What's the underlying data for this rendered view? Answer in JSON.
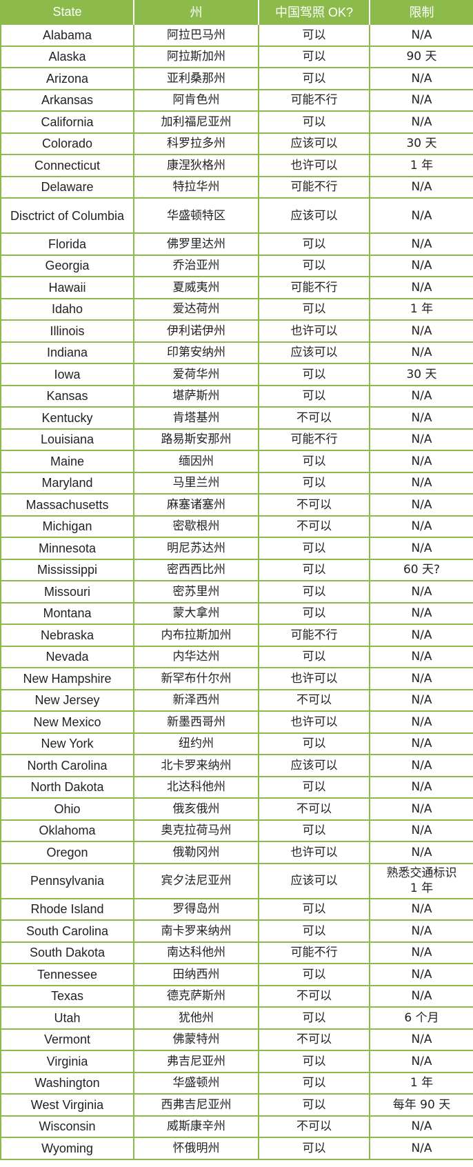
{
  "header": {
    "state": "State",
    "zhou": "州",
    "chinese_license_ok": "中国驾照 OK?",
    "restriction": "限制"
  },
  "colors": {
    "accent": "#8dbb4b",
    "header_text": "#ffffff",
    "body_text": "#222222"
  },
  "rows": [
    {
      "state": "Alabama",
      "zhou": "阿拉巴马州",
      "ok": "可以",
      "limit": "N/A"
    },
    {
      "state": "Alaska",
      "zhou": "阿拉斯加州",
      "ok": "可以",
      "limit": "90 天"
    },
    {
      "state": "Arizona",
      "zhou": "亚利桑那州",
      "ok": "可以",
      "limit": "N/A"
    },
    {
      "state": "Arkansas",
      "zhou": "阿肯色州",
      "ok": "可能不行",
      "limit": "N/A"
    },
    {
      "state": "California",
      "zhou": "加利福尼亚州",
      "ok": "可以",
      "limit": "N/A"
    },
    {
      "state": "Colorado",
      "zhou": "科罗拉多州",
      "ok": "应该可以",
      "limit": "30 天"
    },
    {
      "state": "Connecticut",
      "zhou": "康涅狄格州",
      "ok": "也许可以",
      "limit": "1 年"
    },
    {
      "state": "Delaware",
      "zhou": "特拉华州",
      "ok": "可能不行",
      "limit": "N/A"
    },
    {
      "state": "Disctrict of Columbia",
      "zhou": "华盛顿特区",
      "ok": "应该可以",
      "limit": "N/A"
    },
    {
      "state": "Florida",
      "zhou": "佛罗里达州",
      "ok": "可以",
      "limit": "N/A"
    },
    {
      "state": "Georgia",
      "zhou": "乔治亚州",
      "ok": "可以",
      "limit": "N/A"
    },
    {
      "state": "Hawaii",
      "zhou": "夏威夷州",
      "ok": "可能不行",
      "limit": "N/A"
    },
    {
      "state": "Idaho",
      "zhou": "爱达荷州",
      "ok": "可以",
      "limit": "1 年"
    },
    {
      "state": "Illinois",
      "zhou": "伊利诺伊州",
      "ok": "也许可以",
      "limit": "N/A"
    },
    {
      "state": "Indiana",
      "zhou": "印第安纳州",
      "ok": "应该可以",
      "limit": "N/A"
    },
    {
      "state": "Iowa",
      "zhou": "爱荷华州",
      "ok": "可以",
      "limit": "30 天"
    },
    {
      "state": "Kansas",
      "zhou": "堪萨斯州",
      "ok": "可以",
      "limit": "N/A"
    },
    {
      "state": "Kentucky",
      "zhou": "肯塔基州",
      "ok": "不可以",
      "limit": "N/A"
    },
    {
      "state": "Louisiana",
      "zhou": "路易斯安那州",
      "ok": "可能不行",
      "limit": "N/A"
    },
    {
      "state": "Maine",
      "zhou": "缅因州",
      "ok": "可以",
      "limit": "N/A"
    },
    {
      "state": "Maryland",
      "zhou": "马里兰州",
      "ok": "可以",
      "limit": "N/A"
    },
    {
      "state": "Massachusetts",
      "zhou": "麻塞诸塞州",
      "ok": "不可以",
      "limit": "N/A"
    },
    {
      "state": "Michigan",
      "zhou": "密歇根州",
      "ok": "不可以",
      "limit": "N/A"
    },
    {
      "state": "Minnesota",
      "zhou": "明尼苏达州",
      "ok": "可以",
      "limit": "N/A"
    },
    {
      "state": "Mississippi",
      "zhou": "密西西比州",
      "ok": "可以",
      "limit": "60 天?"
    },
    {
      "state": "Missouri",
      "zhou": "密苏里州",
      "ok": "可以",
      "limit": "N/A"
    },
    {
      "state": "Montana",
      "zhou": "蒙大拿州",
      "ok": "可以",
      "limit": "N/A"
    },
    {
      "state": "Nebraska",
      "zhou": "内布拉斯加州",
      "ok": "可能不行",
      "limit": "N/A"
    },
    {
      "state": "Nevada",
      "zhou": "内华达州",
      "ok": "可以",
      "limit": "N/A"
    },
    {
      "state": "New Hampshire",
      "zhou": "新罕布什尔州",
      "ok": "也许可以",
      "limit": "N/A"
    },
    {
      "state": "New Jersey",
      "zhou": "新泽西州",
      "ok": "不可以",
      "limit": "N/A"
    },
    {
      "state": "New Mexico",
      "zhou": "新墨西哥州",
      "ok": "也许可以",
      "limit": "N/A"
    },
    {
      "state": "New York",
      "zhou": "纽约州",
      "ok": "可以",
      "limit": "N/A"
    },
    {
      "state": "North Carolina",
      "zhou": "北卡罗来纳州",
      "ok": "应该可以",
      "limit": "N/A"
    },
    {
      "state": "North Dakota",
      "zhou": "北达科他州",
      "ok": "可以",
      "limit": "N/A"
    },
    {
      "state": "Ohio",
      "zhou": "俄亥俄州",
      "ok": "不可以",
      "limit": "N/A"
    },
    {
      "state": "Oklahoma",
      "zhou": "奥克拉荷马州",
      "ok": "可以",
      "limit": "N/A"
    },
    {
      "state": "Oregon",
      "zhou": "俄勒冈州",
      "ok": "也许可以",
      "limit": "N/A"
    },
    {
      "state": "Pennsylvania",
      "zhou": "宾夕法尼亚州",
      "ok": "应该可以",
      "limit": "熟悉交通标识",
      "limit2": "1 年"
    },
    {
      "state": "Rhode Island",
      "zhou": "罗得岛州",
      "ok": "可以",
      "limit": "N/A"
    },
    {
      "state": "South Carolina",
      "zhou": "南卡罗来纳州",
      "ok": "可以",
      "limit": "N/A"
    },
    {
      "state": "South Dakota",
      "zhou": "南达科他州",
      "ok": "可能不行",
      "limit": "N/A"
    },
    {
      "state": "Tennessee",
      "zhou": "田纳西州",
      "ok": "可以",
      "limit": "N/A"
    },
    {
      "state": "Texas",
      "zhou": "德克萨斯州",
      "ok": "不可以",
      "limit": "N/A"
    },
    {
      "state": "Utah",
      "zhou": "犹他州",
      "ok": "可以",
      "limit": "6 个月"
    },
    {
      "state": "Vermont",
      "zhou": "佛蒙特州",
      "ok": "不可以",
      "limit": "N/A"
    },
    {
      "state": "Virginia",
      "zhou": "弗吉尼亚州",
      "ok": "可以",
      "limit": "N/A"
    },
    {
      "state": "Washington",
      "zhou": "华盛顿州",
      "ok": "可以",
      "limit": "1 年"
    },
    {
      "state": "West Virginia",
      "zhou": "西弗吉尼亚州",
      "ok": "可以",
      "limit": "每年 90 天"
    },
    {
      "state": "Wisconsin",
      "zhou": "威斯康辛州",
      "ok": "不可以",
      "limit": "N/A"
    },
    {
      "state": "Wyoming",
      "zhou": "怀俄明州",
      "ok": "可以",
      "limit": "N/A"
    }
  ]
}
